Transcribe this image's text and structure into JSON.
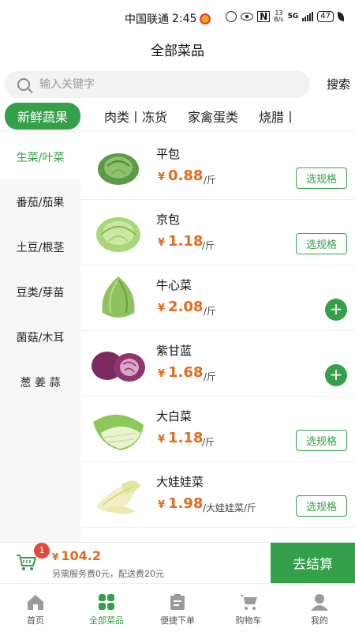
{
  "status_bar": {
    "carrier": "中国联通",
    "time": "2:45",
    "net_speed_value": "13",
    "net_speed_unit": "B/s",
    "network": "5G",
    "battery": "47"
  },
  "header": {
    "title": "全部菜品"
  },
  "search": {
    "placeholder": "输入关键字",
    "button_label": "搜索"
  },
  "categories": [
    "新鲜蔬果",
    "肉类丨冻货",
    "家禽蛋类",
    "烧腊丨"
  ],
  "sidebar": {
    "items": [
      "生菜/叶菜",
      "番茄/茄果",
      "土豆/根茎",
      "豆类/芽苗",
      "菌菇/木耳",
      "葱 姜 蒜"
    ]
  },
  "currency_symbol": "¥",
  "products": [
    {
      "name": "平包",
      "price": "0.88",
      "unit": "/斤",
      "action": "选规格",
      "icon": "round-cabbage-dark"
    },
    {
      "name": "京包",
      "price": "1.18",
      "unit": "/斤",
      "action": "选规格",
      "icon": "round-cabbage-light"
    },
    {
      "name": "牛心菜",
      "price": "2.08",
      "unit": "/斤",
      "action": "+",
      "icon": "pointed-cabbage"
    },
    {
      "name": "紫甘蓝",
      "price": "1.68",
      "unit": "/斤",
      "action": "+",
      "icon": "red-cabbage"
    },
    {
      "name": "大白菜",
      "price": "1.18",
      "unit": "/斤",
      "action": "选规格",
      "icon": "napa-cabbage"
    },
    {
      "name": "大娃娃菜",
      "price": "1.98",
      "unit": "/大娃娃菜/斤",
      "action": "选规格",
      "icon": "baby-cabbage"
    }
  ],
  "cart": {
    "badge_count": "1",
    "total": "104.2",
    "note": "另需服务费0元，配送费20元",
    "checkout_label": "去结算"
  },
  "tab_bar": {
    "items": [
      {
        "label": "首页",
        "icon": "home-icon"
      },
      {
        "label": "全部菜品",
        "icon": "grid-icon"
      },
      {
        "label": "便捷下单",
        "icon": "clipboard-icon"
      },
      {
        "label": "购物车",
        "icon": "cart-icon"
      },
      {
        "label": "我的",
        "icon": "user-icon"
      }
    ],
    "active_index": 1
  },
  "colors": {
    "accent": "#34a04a",
    "price": "#e46a1c",
    "badge": "#e04a3c"
  }
}
